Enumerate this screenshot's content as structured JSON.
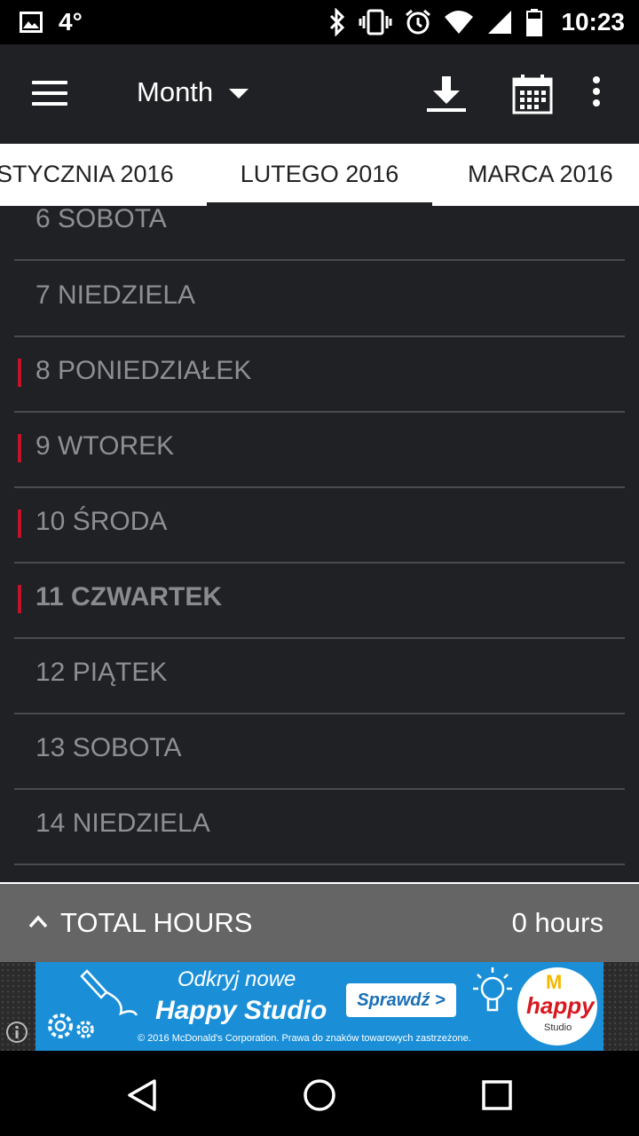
{
  "status_bar": {
    "temperature": "4°",
    "time": "10:23",
    "icons": [
      "image-icon",
      "bluetooth-icon",
      "vibrate-icon",
      "alarm-icon",
      "wifi-icon",
      "signal-icon",
      "battery-icon"
    ]
  },
  "toolbar": {
    "title": "Month",
    "icons": [
      "menu-icon",
      "dropdown-caret-icon",
      "download-icon",
      "calendar-icon",
      "more-vert-icon"
    ]
  },
  "tabs": {
    "prev": "STYCZNIA 2016",
    "current": "LUTEGO 2016",
    "next": "MARCA 2016"
  },
  "days": [
    {
      "label": "6 SOBOTA",
      "marker": false,
      "bold": false
    },
    {
      "label": "7 NIEDZIELA",
      "marker": false,
      "bold": false
    },
    {
      "label": "8 PONIEDZIAŁEK",
      "marker": true,
      "bold": false
    },
    {
      "label": "9 WTOREK",
      "marker": true,
      "bold": false
    },
    {
      "label": "10 ŚRODA",
      "marker": true,
      "bold": false
    },
    {
      "label": "11 CZWARTEK",
      "marker": true,
      "bold": true
    },
    {
      "label": "12 PIĄTEK",
      "marker": false,
      "bold": false
    },
    {
      "label": "13 SOBOTA",
      "marker": false,
      "bold": false
    },
    {
      "label": "14 NIEDZIELA",
      "marker": false,
      "bold": false
    }
  ],
  "total": {
    "label": "TOTAL HOURS",
    "value": "0 hours"
  },
  "ad": {
    "line1": "Odkryj nowe",
    "line2": "Happy Studio",
    "button": "Sprawdź >",
    "footer": "© 2016 McDonald's Corporation. Prawa do znaków towarowych zastrzeżone.",
    "logo_m": "M",
    "logo_text": "happy",
    "logo_sub": "Studio"
  },
  "colors": {
    "background": "#202124",
    "marker": "#c2132b",
    "total_bar": "#656565",
    "ad_blue": "#1a8fd8"
  }
}
